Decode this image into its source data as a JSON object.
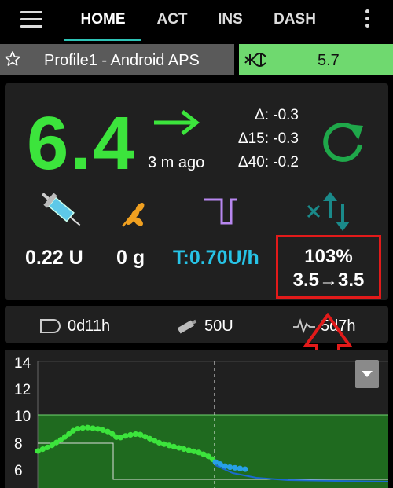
{
  "tabs": [
    {
      "label": "HOME",
      "active": true
    },
    {
      "label": "ACT",
      "active": false
    },
    {
      "label": "INS",
      "active": false
    },
    {
      "label": "DASH",
      "active": false
    }
  ],
  "profile": {
    "label": "Profile1 - Android APS"
  },
  "target": {
    "value": "5.7"
  },
  "overview": {
    "bg": "6.4",
    "time_ago": "3 m ago",
    "delta": "Δ: -0.3",
    "delta15": "Δ15: -0.3",
    "delta40": "Δ40: -0.2",
    "iob": "0.22 U",
    "cob": "0 g",
    "basal": "T:0.70U/h",
    "percentage": "103%",
    "target_range": "3.5→3.5"
  },
  "status": {
    "cannula_age": "0d11h",
    "reservoir": "50U",
    "sensor_age": "5d7h"
  },
  "graph": {
    "y_labels": [
      "14",
      "12",
      "10",
      "8",
      "6"
    ]
  },
  "colors": {
    "bg_green": "#3ce43c",
    "tab_accent": "#2ec4b6",
    "basal_cyan": "#27c3e6",
    "highlight_red": "#e21a1a",
    "target_green": "#6fd96f"
  }
}
